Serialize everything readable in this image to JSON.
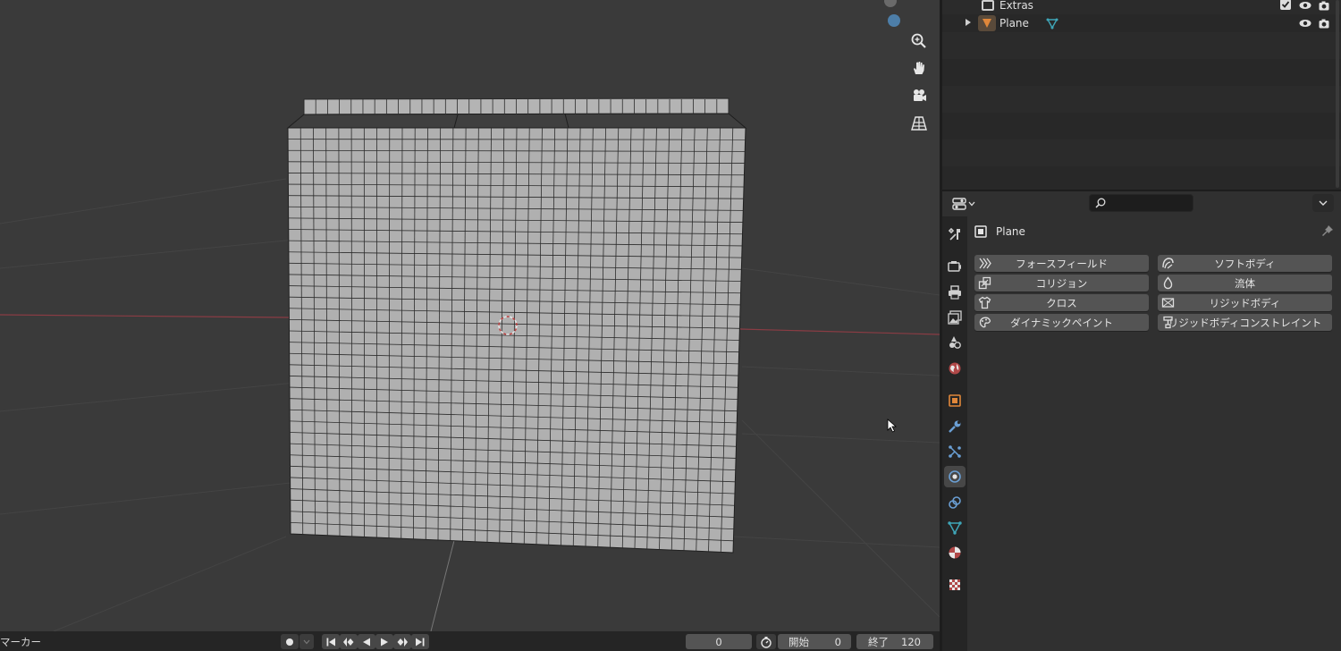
{
  "outliner": {
    "rows": [
      {
        "label": "Extras",
        "kind": "collection"
      },
      {
        "label": "Plane",
        "kind": "mesh-object"
      }
    ]
  },
  "properties": {
    "search": {
      "placeholder": "",
      "value": ""
    },
    "context": {
      "object_name": "Plane"
    },
    "physics_buttons": [
      {
        "label": "フォースフィールド",
        "icon": "force-field-icon"
      },
      {
        "label": "ソフトボディ",
        "icon": "soft-body-icon"
      },
      {
        "label": "コリジョン",
        "icon": "collision-icon"
      },
      {
        "label": "流体",
        "icon": "fluid-icon"
      },
      {
        "label": "クロス",
        "icon": "cloth-icon"
      },
      {
        "label": "リジッドボディ",
        "icon": "rigid-body-icon"
      },
      {
        "label": "ダイナミックペイント",
        "icon": "dynamic-paint-icon"
      },
      {
        "label": "リジッドボディコンストレイント",
        "icon": "rigid-body-constraint-icon"
      }
    ],
    "tabs": [
      "tool",
      "render",
      "output",
      "view-layer",
      "scene",
      "world",
      "object",
      "modifiers",
      "particles",
      "physics",
      "constraints",
      "data",
      "material",
      "texture"
    ],
    "active_tab": "physics"
  },
  "timeline": {
    "marker_menu": "マーカー",
    "current_frame": "0",
    "start_label": "開始",
    "start_value": "0",
    "end_label": "終了",
    "end_value": "120"
  },
  "colors": {
    "accent_orange": "#e0873a",
    "physics_blue": "#6a9fd4",
    "button_bg": "#545454",
    "panel_bg": "#303030",
    "viewport_bg": "#3a3a3a"
  }
}
